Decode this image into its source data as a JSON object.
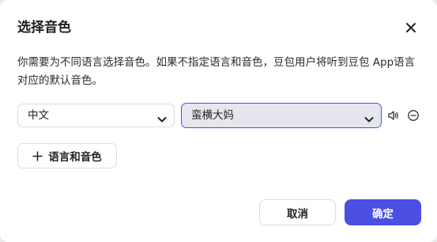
{
  "dialog": {
    "title": "选择音色",
    "description": "你需要为不同语言选择音色。如果不指定语言和音色，豆包用户将听到豆包 App语言对应的默认音色。",
    "language_select": {
      "value": "中文"
    },
    "voice_select": {
      "value": "蛮横大妈"
    },
    "add_button_label": "语言和音色",
    "cancel_label": "取消",
    "confirm_label": "确定"
  },
  "colors": {
    "primary": "#4b4fe2",
    "focus_border": "#4b53e0",
    "voice_select_bg": "#e6e7ee"
  },
  "icons": [
    "close-icon",
    "chevron-down-icon",
    "speaker-icon",
    "remove-circle-icon",
    "plus-icon"
  ]
}
